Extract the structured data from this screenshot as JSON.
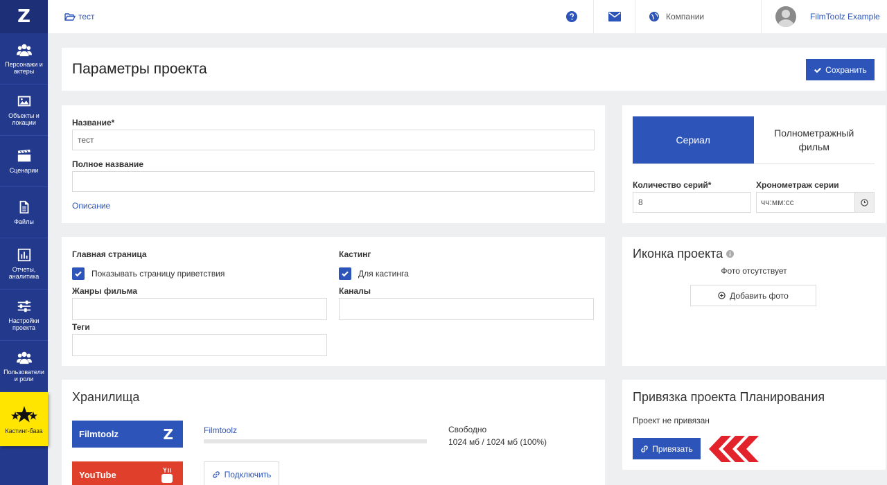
{
  "sidebar": {
    "logo": "Z",
    "items": [
      {
        "label": "Персонажи и актеры",
        "icon": "users-icon"
      },
      {
        "label": "Объекты и локации",
        "icon": "image-icon"
      },
      {
        "label": "Сценарии",
        "icon": "clapperboard-icon"
      },
      {
        "label": "Файлы",
        "icon": "file-icon"
      },
      {
        "label": "Отчеты, аналитика",
        "icon": "bar-chart-icon"
      },
      {
        "label": "Настройки проекта",
        "icon": "sliders-icon"
      },
      {
        "label": "Пользователи и роли",
        "icon": "users-icon"
      },
      {
        "label": "Кастинг-база",
        "icon": "stars-icon"
      }
    ]
  },
  "topbar": {
    "breadcrumb": "тест",
    "companies": "Компании",
    "user": "FilmToolz Example"
  },
  "page": {
    "title": "Параметры проекта",
    "save": "Сохранить"
  },
  "basic": {
    "name_label": "Название",
    "required_mark": "*",
    "name_value": "тест",
    "full_name_label": "Полное название",
    "full_name_value": "",
    "description_link": "Описание"
  },
  "type": {
    "tab_series": "Сериал",
    "tab_film": "Полнометражный фильм",
    "episodes_label": "Количество серий",
    "episodes_value": "8",
    "duration_label": "Хронометраж серии",
    "duration_placeholder": "чч:мм:сс"
  },
  "settings": {
    "main_page_label": "Главная страница",
    "welcome_check": "Показывать страницу приветствия",
    "welcome_checked": true,
    "genres_label": "Жанры фильма",
    "tags_label": "Теги",
    "casting_label": "Кастинг",
    "casting_check": "Для кастинга",
    "casting_checked": true,
    "channels_label": "Каналы"
  },
  "icon_panel": {
    "title": "Иконка проекта",
    "no_photo": "Фото отсутствует",
    "add_photo": "Добавить фото"
  },
  "storage": {
    "title": "Хранилища",
    "filmtoolz_brand": "Filmtoolz",
    "filmtoolz_link": "Filmtoolz",
    "free_label": "Свободно",
    "free_value": "1024 мб / 1024 мб (100%)",
    "used_fraction": 0,
    "youtube_brand": "YouTube",
    "connect": "Подключить"
  },
  "planning": {
    "title": "Привязка проекта Планирования",
    "status": "Проект не привязан",
    "bind": "Привязать"
  },
  "colors": {
    "primary": "#2d54b8",
    "sidebar": "#233a8c",
    "casting_highlight": "#ffe500",
    "youtube": "#e0402b",
    "arrow": "#e3232b"
  }
}
